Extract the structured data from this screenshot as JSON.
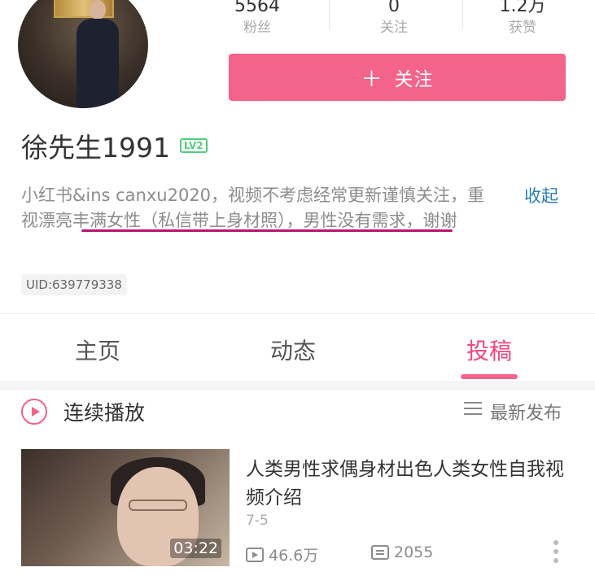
{
  "profile": {
    "username": "徐先生1991",
    "level": "LV2",
    "bio": "小红书&ins canxu2020，视频不考虑经常更新谨慎关注，重视漂亮丰满女性（私信带上身材照），男性没有需求，谢谢",
    "collapse_label": "收起",
    "uid": "UID:639779338"
  },
  "stats": {
    "followers": {
      "value": "5564",
      "label": "粉丝"
    },
    "following": {
      "value": "0",
      "label": "关注"
    },
    "likes": {
      "value": "1.2万",
      "label": "获赞"
    }
  },
  "follow_button": {
    "icon": "plus-icon",
    "label": "关注"
  },
  "tabs": [
    {
      "label": "主页"
    },
    {
      "label": "动态"
    },
    {
      "label": "投稿",
      "active": true
    }
  ],
  "playlist": {
    "continuous_play_label": "连续播放",
    "sort_label": "最新发布"
  },
  "video": {
    "title": "人类男性求偶身材出色人类女性自我视频介绍",
    "date": "7-5",
    "duration": "03:22",
    "views": "46.6万",
    "comments": "2055"
  },
  "colors": {
    "accent": "#f4638a",
    "active_tab": "#f0477d",
    "link": "#2d7fb8",
    "underline": "#b8166f"
  }
}
